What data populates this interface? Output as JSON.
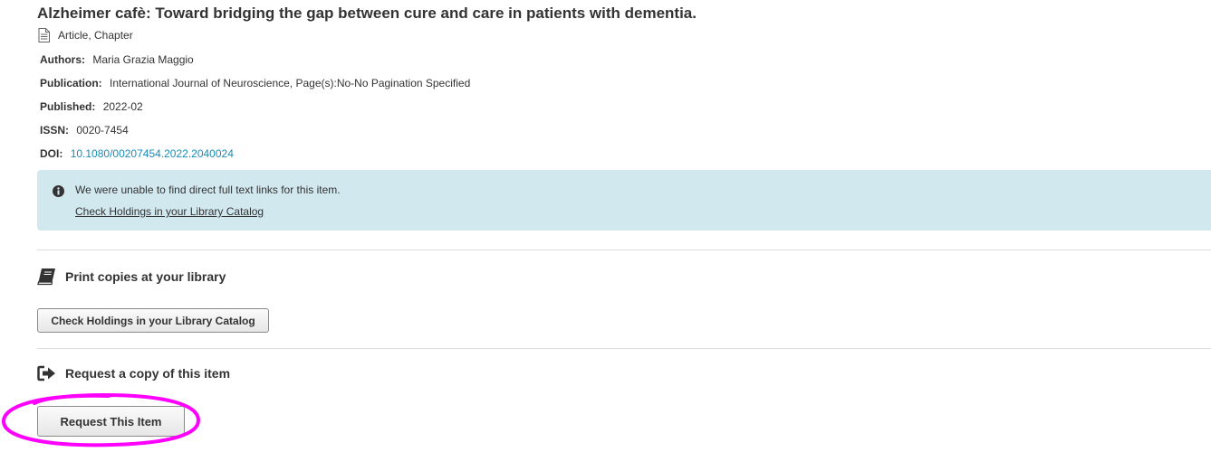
{
  "record": {
    "title": "Alzheimer cafè: Toward bridging the gap between cure and care in patients with dementia.",
    "type": "Article, Chapter",
    "fields": [
      {
        "label": "Authors:",
        "value": "Maria Grazia Maggio",
        "is_link": false
      },
      {
        "label": "Publication:",
        "value": "International Journal of Neuroscience, Page(s):No-No Pagination Specified",
        "is_link": false
      },
      {
        "label": "Published:",
        "value": "2022-02",
        "is_link": false
      },
      {
        "label": "ISSN:",
        "value": "0020-7454",
        "is_link": false
      },
      {
        "label": "DOI:",
        "value": "10.1080/00207454.2022.2040024",
        "is_link": true
      }
    ]
  },
  "alert": {
    "message": "We were unable to find direct full text links for this item.",
    "link_text": "Check Holdings in your Library Catalog",
    "icon": "info-icon",
    "background": "#d2e8ef"
  },
  "print_section": {
    "heading": "Print copies at your library",
    "icon": "book-icon",
    "button_label": "Check Holdings in your Library Catalog"
  },
  "request_section": {
    "heading": "Request a copy of this item",
    "icon": "sign-out-icon",
    "button_label": "Request This Item"
  },
  "colors": {
    "link": "#1a8cb8",
    "annotation": "#ff00ff"
  }
}
